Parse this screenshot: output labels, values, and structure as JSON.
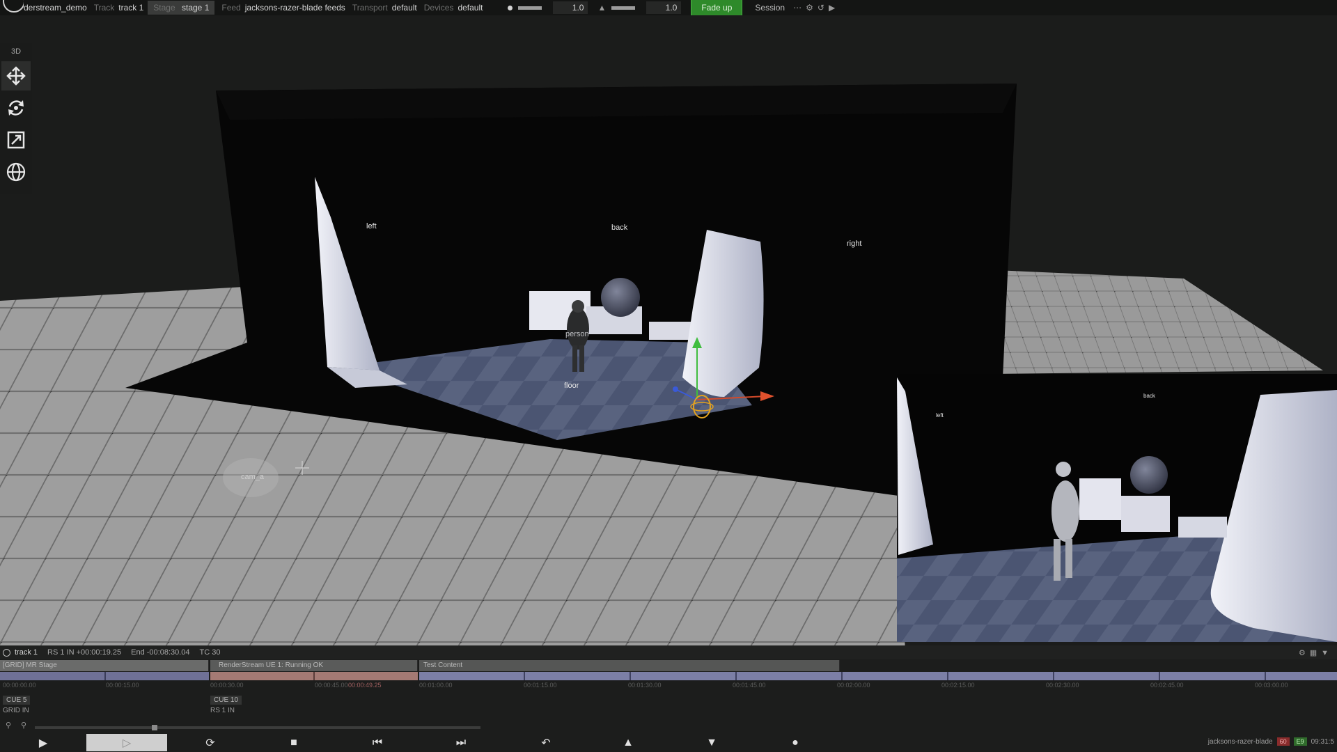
{
  "topbar": {
    "project": "derstream_demo",
    "track_label": "Track",
    "track_value": "track 1",
    "stage_label": "Stage",
    "stage_value": "stage 1",
    "feed_label": "Feed",
    "feed_value": "jacksons-razer-blade feeds",
    "transport_label": "Transport",
    "transport_value": "default",
    "devices_label": "Devices",
    "devices_value": "default",
    "brightness_value": "1.0",
    "volume_value": "1.0",
    "fade_button": "Fade up",
    "session_label": "Session"
  },
  "toolbar": {
    "title": "3D",
    "tools": [
      {
        "name": "move-tool",
        "icon": "move-arrows-icon"
      },
      {
        "name": "rotate-tool",
        "icon": "rotate-icon"
      },
      {
        "name": "scale-tool",
        "icon": "scale-icon"
      },
      {
        "name": "globe-tool",
        "icon": "globe-icon"
      }
    ]
  },
  "scene": {
    "labels": {
      "left": "left",
      "back": "back",
      "right": "right",
      "person": "person",
      "floor": "floor",
      "camera": "cam_a"
    },
    "preview_labels": {
      "left": "left",
      "back": "back"
    }
  },
  "timeline": {
    "track_name": "track 1",
    "rs_in": "RS 1 IN +00:00:19.25",
    "end": "End -00:08:30.04",
    "tc": "TC 30",
    "layers": [
      {
        "label": "[GRID] MR Stage"
      },
      {
        "label": "RenderStream UE 1: Running OK"
      },
      {
        "label": "Test Content"
      }
    ],
    "ruler": [
      "00:00:00.00",
      "00:00:15.00",
      "00:00:30.00",
      "00:00:45.00",
      "00:01:00.00",
      "00:01:15.00",
      "00:01:30.00",
      "00:01:45.00",
      "00:02:00.00",
      "00:02:15.00",
      "00:02:30.00",
      "00:02:45.00",
      "00:03:00.00"
    ],
    "playhead_time": "00:00:49.25",
    "cue5": "CUE 5",
    "cue5_sub": "GRID IN",
    "cue10": "CUE 10",
    "cue10_sub": "RS 1 IN",
    "machine": "jacksons-razer-blade",
    "fps_badge": "60",
    "ok_badge": "E9",
    "clock": "09:31:5"
  },
  "colors": {
    "fade_up": "#2e8a2a",
    "layer_grid": "#6a6b6a",
    "layer_render": "#5a5b5a",
    "strip_blue": "#7c7fa6",
    "strip_pink": "#a47a74"
  }
}
